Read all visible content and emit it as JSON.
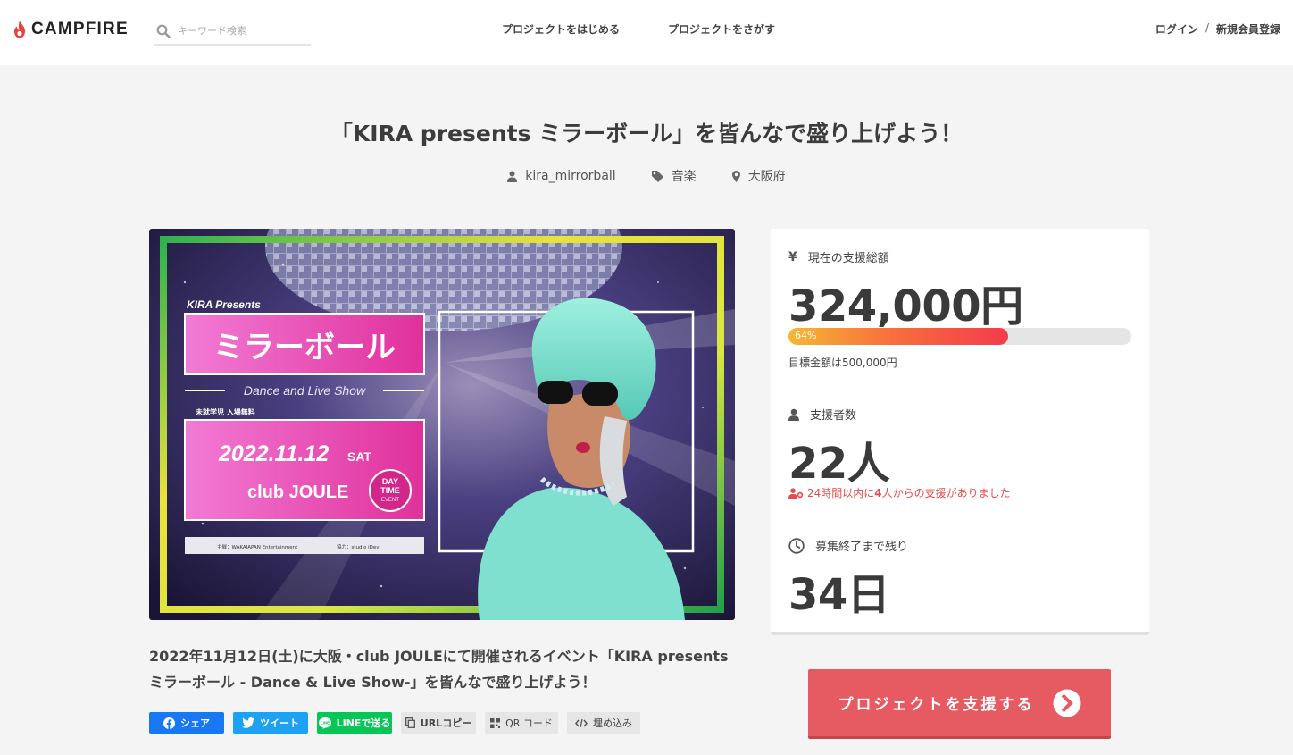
{
  "header": {
    "logo_text": "CAMPFIRE",
    "search_placeholder": "キーワード検索",
    "nav": [
      "プロジェクトをはじめる",
      "プロジェクトをさがす"
    ],
    "login": "ログイン",
    "separator": "/",
    "register": "新規会員登録"
  },
  "project": {
    "title": "「KIRA presents ミラーボール」を皆んなで盛り上げよう！",
    "owner": "kira_mirrorball",
    "category": "音楽",
    "location": "大阪府",
    "description": "2022年11月12日(土)に大阪・club JOULEにて開催されるイベント「KIRA presents ミラーボール - Dance & Live Show-」を皆んなで盛り上げよう！"
  },
  "hero": {
    "presenter": "KIRA Presents",
    "event_name": "ミラーボール",
    "subtitle": "Dance and Live Show",
    "notice": "未就学児 入場無料",
    "date": "2022.11.12",
    "weekday": "SAT",
    "venue": "club JOULE",
    "badge_line1": "DAY",
    "badge_line2": "TIME",
    "badge_line3": "EVENT",
    "footer_sponsor": "主催：WAKAJAPAN Entertainment",
    "footer_coop": "協力：studio iDey"
  },
  "share": {
    "facebook": "シェア",
    "twitter": "ツイート",
    "line": "LINEで送る",
    "url": "URLコピー",
    "qr": "QR コード",
    "embed": "埋め込み"
  },
  "stats": {
    "currency_symbol": "¥",
    "total_label": "現在の支援総額",
    "total_value": "324,000円",
    "progress_percent": 64,
    "progress_text": "64%",
    "goal_text": "目標金額は500,000円",
    "backers_label": "支援者数",
    "backers_value": "22人",
    "recent_prefix": "24時間以内に",
    "recent_count": "4",
    "recent_suffix": "人からの支援がありました",
    "remaining_label": "募集終了まで残り",
    "remaining_value": "34日"
  },
  "support_button": "プロジェクトを支援する",
  "colors": {
    "accent": "#e65a62",
    "recent_text": "#e64c4c",
    "facebook": "#1877f2",
    "twitter": "#1da1f2",
    "line": "#06c755"
  }
}
